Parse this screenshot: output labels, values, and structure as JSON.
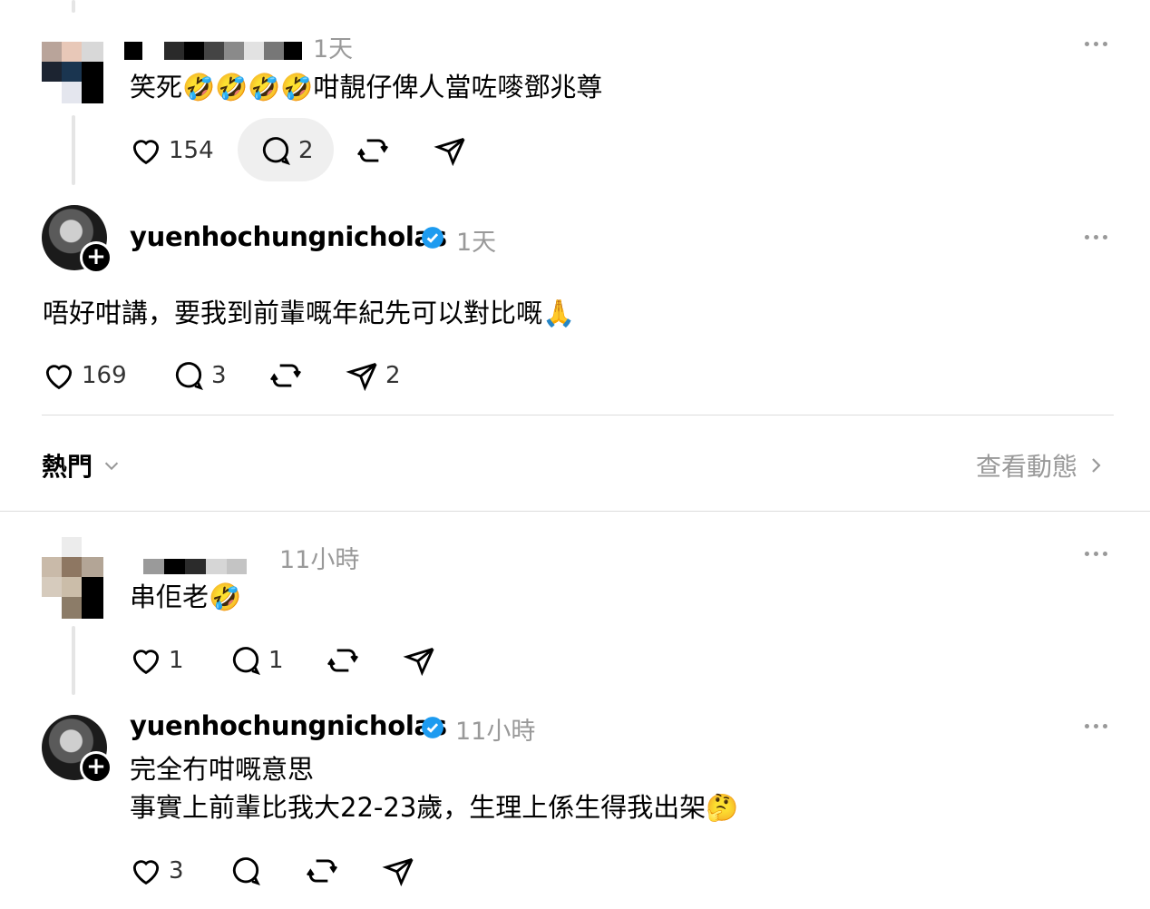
{
  "colors": {
    "verified": "#1d9bf0",
    "muted": "#999999",
    "divider": "#dcdcdc"
  },
  "comment1": {
    "time": "1天",
    "text": "笑死🤣🤣🤣🤣咁靚仔俾人當咗嘜鄧兆尊",
    "likes": "154",
    "replies": "2"
  },
  "reply1": {
    "username": "yuenhochungnicholas",
    "time": "1天",
    "text": "唔好咁講，要我到前輩嘅年紀先可以對比嘅🙏",
    "likes": "169",
    "replies": "3",
    "shares": "2"
  },
  "section": {
    "sort_label": "熱門",
    "view_activity": "查看動態"
  },
  "comment2": {
    "time": "11小時",
    "text": "串佢老🤣",
    "likes": "1",
    "replies": "1"
  },
  "reply2": {
    "username": "yuenhochungnicholas",
    "time": "11小時",
    "text_line1": "完全冇咁嘅意思",
    "text_line2": "事實上前輩比我大22-23歲，生理上係生得我出架🤔",
    "likes": "3"
  },
  "icons": [
    "heart-icon",
    "comment-icon",
    "repost-icon",
    "share-icon",
    "more-icon",
    "verified-badge-icon",
    "chevron-down-icon",
    "chevron-right-icon",
    "follow-plus-icon"
  ]
}
